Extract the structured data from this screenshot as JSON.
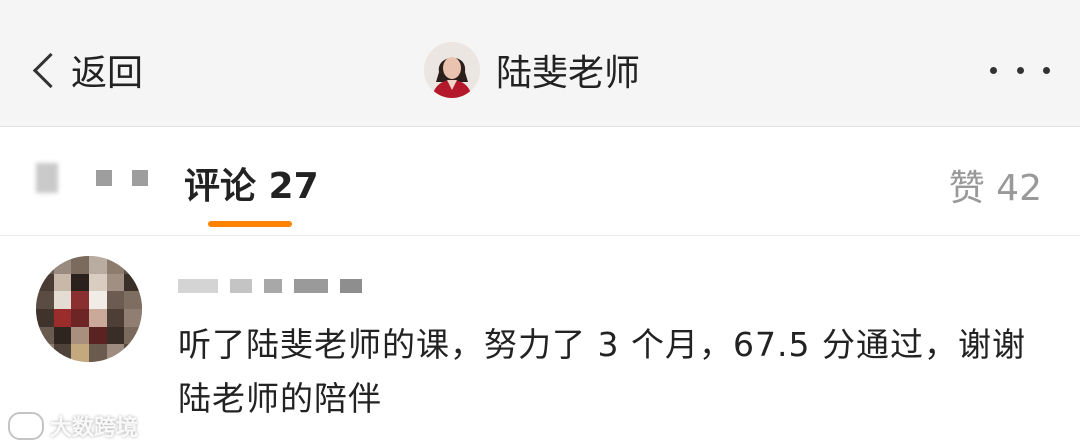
{
  "navbar": {
    "back_label": "返回",
    "title": "陆斐老师",
    "avatar_icon": "user-avatar-photo",
    "more_icon": "ellipsis-icon"
  },
  "tabs": {
    "comment_label": "评论 27",
    "like_label": "赞 42",
    "active_color": "#ff8200"
  },
  "comment": {
    "text": "听了陆斐老师的课，努力了 3 个月，67.5 分通过，谢谢陆老师的陪伴"
  },
  "watermark": {
    "text": "大数跨境"
  }
}
